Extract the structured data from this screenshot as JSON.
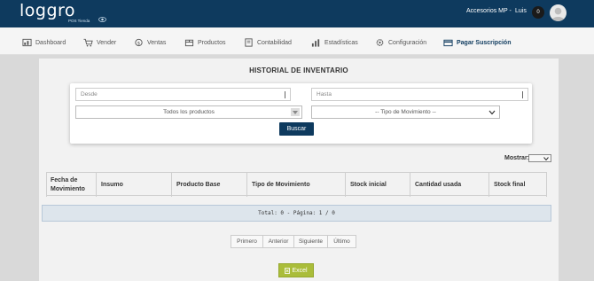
{
  "header": {
    "logo_text": "loggro",
    "logo_sub": "POS Tienda",
    "account_label": "Accesorios MP -",
    "user_name": "Luis",
    "notification_count": "0"
  },
  "nav": {
    "items": [
      {
        "label": "Dashboard",
        "icon": "dashboard-icon"
      },
      {
        "label": "Vender",
        "icon": "cart-icon"
      },
      {
        "label": "Ventas",
        "icon": "money-icon"
      },
      {
        "label": "Productos",
        "icon": "box-icon"
      },
      {
        "label": "Contabilidad",
        "icon": "ledger-icon"
      },
      {
        "label": "Estadísticas",
        "icon": "bar-chart-icon"
      },
      {
        "label": "Configuración",
        "icon": "settings-icon"
      },
      {
        "label": "Pagar Suscripción",
        "icon": "card-icon"
      }
    ],
    "active_color": "#0e3a5e"
  },
  "page": {
    "title": "HISTORIAL DE INVENTARIO"
  },
  "filters": {
    "desde_placeholder": "Desde",
    "hasta_placeholder": "Hasta",
    "products_selected": "Todos los productos",
    "movement_selected": "-- Tipo de Movimiento --",
    "search_label": "Buscar"
  },
  "mostrar": {
    "label": "Mostrar:",
    "value": ""
  },
  "table": {
    "columns": [
      "Fecha de Movimiento",
      "Insumo",
      "Producto Base",
      "Tipo de Movimiento",
      "Stock inicial",
      "Cantidad usada",
      "Stock final"
    ],
    "rows": []
  },
  "summary": {
    "text": "Total: 0 - Página: 1 / 0"
  },
  "pagination": {
    "first": "Primero",
    "prev": "Anterior",
    "next": "Siguiente",
    "last": "Último"
  },
  "export": {
    "excel_label": "Excel",
    "color": "#aabd3a"
  },
  "colors": {
    "brand": "#0e3a5e",
    "background": "#d9d9d9"
  }
}
